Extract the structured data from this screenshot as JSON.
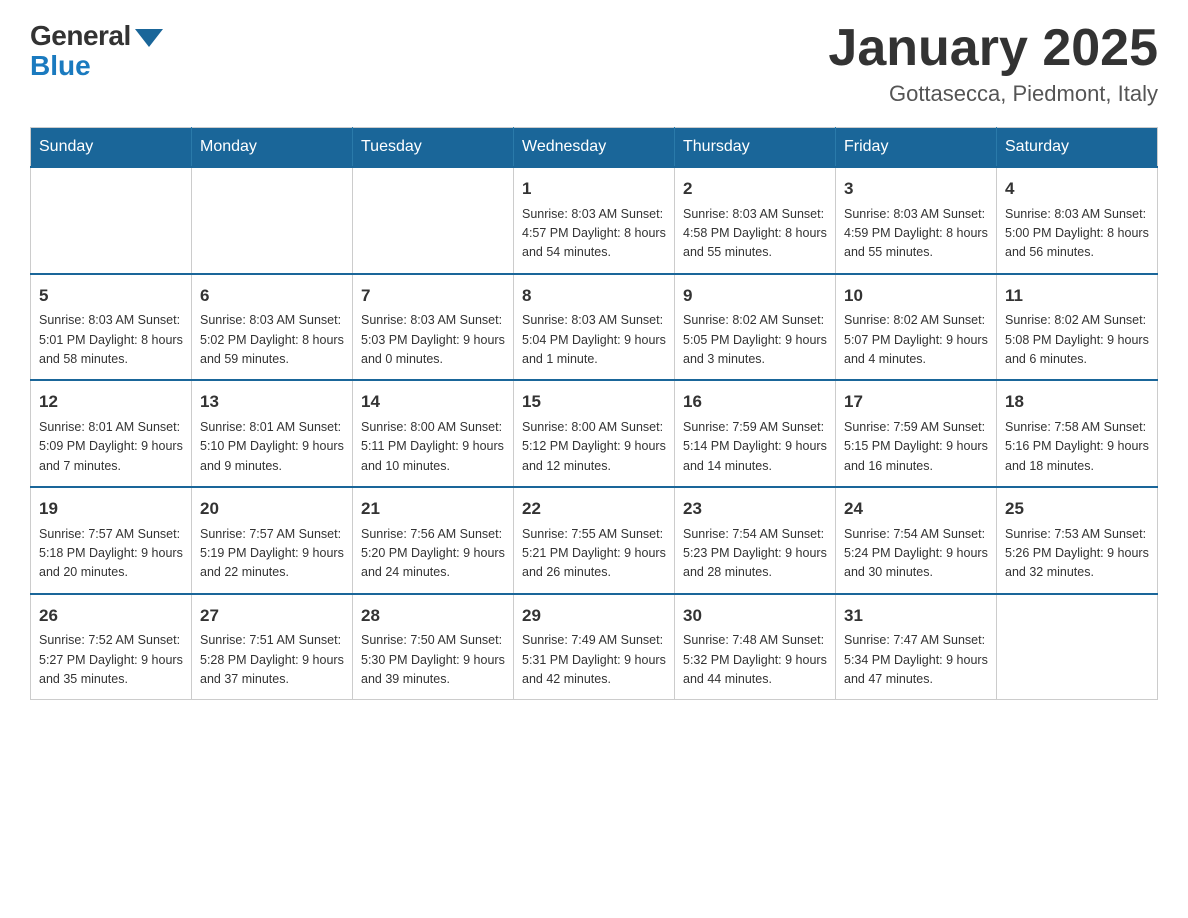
{
  "header": {
    "logo_general": "General",
    "logo_blue": "Blue",
    "month_title": "January 2025",
    "location": "Gottasecca, Piedmont, Italy"
  },
  "weekdays": [
    "Sunday",
    "Monday",
    "Tuesday",
    "Wednesday",
    "Thursday",
    "Friday",
    "Saturday"
  ],
  "weeks": [
    [
      {
        "day": "",
        "info": ""
      },
      {
        "day": "",
        "info": ""
      },
      {
        "day": "",
        "info": ""
      },
      {
        "day": "1",
        "info": "Sunrise: 8:03 AM\nSunset: 4:57 PM\nDaylight: 8 hours\nand 54 minutes."
      },
      {
        "day": "2",
        "info": "Sunrise: 8:03 AM\nSunset: 4:58 PM\nDaylight: 8 hours\nand 55 minutes."
      },
      {
        "day": "3",
        "info": "Sunrise: 8:03 AM\nSunset: 4:59 PM\nDaylight: 8 hours\nand 55 minutes."
      },
      {
        "day": "4",
        "info": "Sunrise: 8:03 AM\nSunset: 5:00 PM\nDaylight: 8 hours\nand 56 minutes."
      }
    ],
    [
      {
        "day": "5",
        "info": "Sunrise: 8:03 AM\nSunset: 5:01 PM\nDaylight: 8 hours\nand 58 minutes."
      },
      {
        "day": "6",
        "info": "Sunrise: 8:03 AM\nSunset: 5:02 PM\nDaylight: 8 hours\nand 59 minutes."
      },
      {
        "day": "7",
        "info": "Sunrise: 8:03 AM\nSunset: 5:03 PM\nDaylight: 9 hours\nand 0 minutes."
      },
      {
        "day": "8",
        "info": "Sunrise: 8:03 AM\nSunset: 5:04 PM\nDaylight: 9 hours\nand 1 minute."
      },
      {
        "day": "9",
        "info": "Sunrise: 8:02 AM\nSunset: 5:05 PM\nDaylight: 9 hours\nand 3 minutes."
      },
      {
        "day": "10",
        "info": "Sunrise: 8:02 AM\nSunset: 5:07 PM\nDaylight: 9 hours\nand 4 minutes."
      },
      {
        "day": "11",
        "info": "Sunrise: 8:02 AM\nSunset: 5:08 PM\nDaylight: 9 hours\nand 6 minutes."
      }
    ],
    [
      {
        "day": "12",
        "info": "Sunrise: 8:01 AM\nSunset: 5:09 PM\nDaylight: 9 hours\nand 7 minutes."
      },
      {
        "day": "13",
        "info": "Sunrise: 8:01 AM\nSunset: 5:10 PM\nDaylight: 9 hours\nand 9 minutes."
      },
      {
        "day": "14",
        "info": "Sunrise: 8:00 AM\nSunset: 5:11 PM\nDaylight: 9 hours\nand 10 minutes."
      },
      {
        "day": "15",
        "info": "Sunrise: 8:00 AM\nSunset: 5:12 PM\nDaylight: 9 hours\nand 12 minutes."
      },
      {
        "day": "16",
        "info": "Sunrise: 7:59 AM\nSunset: 5:14 PM\nDaylight: 9 hours\nand 14 minutes."
      },
      {
        "day": "17",
        "info": "Sunrise: 7:59 AM\nSunset: 5:15 PM\nDaylight: 9 hours\nand 16 minutes."
      },
      {
        "day": "18",
        "info": "Sunrise: 7:58 AM\nSunset: 5:16 PM\nDaylight: 9 hours\nand 18 minutes."
      }
    ],
    [
      {
        "day": "19",
        "info": "Sunrise: 7:57 AM\nSunset: 5:18 PM\nDaylight: 9 hours\nand 20 minutes."
      },
      {
        "day": "20",
        "info": "Sunrise: 7:57 AM\nSunset: 5:19 PM\nDaylight: 9 hours\nand 22 minutes."
      },
      {
        "day": "21",
        "info": "Sunrise: 7:56 AM\nSunset: 5:20 PM\nDaylight: 9 hours\nand 24 minutes."
      },
      {
        "day": "22",
        "info": "Sunrise: 7:55 AM\nSunset: 5:21 PM\nDaylight: 9 hours\nand 26 minutes."
      },
      {
        "day": "23",
        "info": "Sunrise: 7:54 AM\nSunset: 5:23 PM\nDaylight: 9 hours\nand 28 minutes."
      },
      {
        "day": "24",
        "info": "Sunrise: 7:54 AM\nSunset: 5:24 PM\nDaylight: 9 hours\nand 30 minutes."
      },
      {
        "day": "25",
        "info": "Sunrise: 7:53 AM\nSunset: 5:26 PM\nDaylight: 9 hours\nand 32 minutes."
      }
    ],
    [
      {
        "day": "26",
        "info": "Sunrise: 7:52 AM\nSunset: 5:27 PM\nDaylight: 9 hours\nand 35 minutes."
      },
      {
        "day": "27",
        "info": "Sunrise: 7:51 AM\nSunset: 5:28 PM\nDaylight: 9 hours\nand 37 minutes."
      },
      {
        "day": "28",
        "info": "Sunrise: 7:50 AM\nSunset: 5:30 PM\nDaylight: 9 hours\nand 39 minutes."
      },
      {
        "day": "29",
        "info": "Sunrise: 7:49 AM\nSunset: 5:31 PM\nDaylight: 9 hours\nand 42 minutes."
      },
      {
        "day": "30",
        "info": "Sunrise: 7:48 AM\nSunset: 5:32 PM\nDaylight: 9 hours\nand 44 minutes."
      },
      {
        "day": "31",
        "info": "Sunrise: 7:47 AM\nSunset: 5:34 PM\nDaylight: 9 hours\nand 47 minutes."
      },
      {
        "day": "",
        "info": ""
      }
    ]
  ]
}
